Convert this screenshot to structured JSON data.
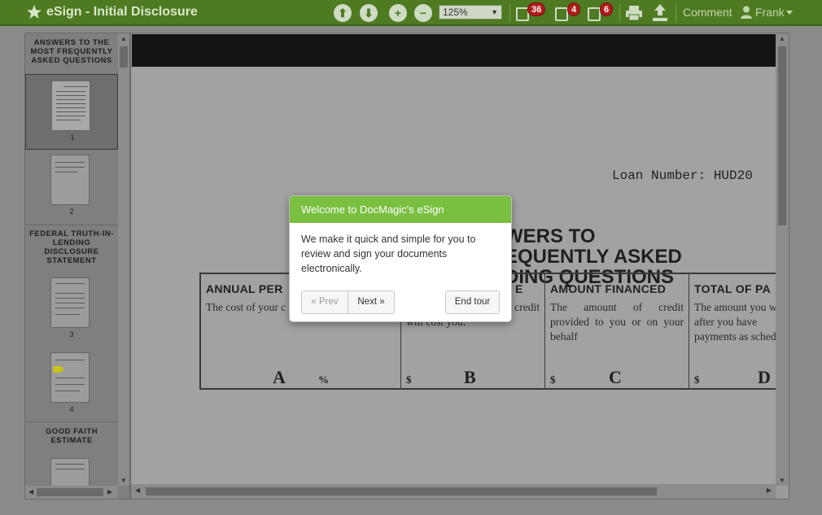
{
  "app": {
    "title": "eSign - Initial Disclosure"
  },
  "toolbar": {
    "zoom_value": "125%",
    "badges": {
      "sign": "36",
      "initial": "4",
      "date": "6"
    },
    "comment_label": "Comment",
    "user_name": "Frank"
  },
  "sidebar": {
    "sections": [
      {
        "title": "ANSWERS TO THE MOST FREQUENTLY ASKED QUESTIONS",
        "pages": [
          "1",
          "2"
        ]
      },
      {
        "title": "FEDERAL TRUTH-IN-LENDING DISCLOSURE STATEMENT",
        "pages": [
          "3",
          "4"
        ]
      },
      {
        "title": "GOOD FAITH ESTIMATE",
        "pages": []
      }
    ]
  },
  "document": {
    "loan_number": "Loan Number: HUD20",
    "title_lines": [
      "WERS TO",
      "EQUENTLY ASKED",
      "DING QUESTIONS"
    ],
    "tila": [
      {
        "head": "ANNUAL PER",
        "body": "The cost of your c",
        "letter": "A",
        "symbol": "%"
      },
      {
        "head": "E",
        "body": "credit",
        "body2": "will cost you.",
        "letter": "B",
        "symbol": "$"
      },
      {
        "head": "AMOUNT FINANCED",
        "body": "The amount of credit provided to you or on your behalf",
        "letter": "C",
        "symbol": "$"
      },
      {
        "head": "TOTAL OF PA",
        "body": "The amount you w after you have payments as sched",
        "letter": "D",
        "symbol": "$"
      }
    ]
  },
  "tour": {
    "title": "Welcome to DocMagic's eSign",
    "body": "We make it quick and simple for you to review and sign your documents electronically.",
    "prev_label": "« Prev",
    "next_label": "Next »",
    "end_label": "End tour"
  }
}
